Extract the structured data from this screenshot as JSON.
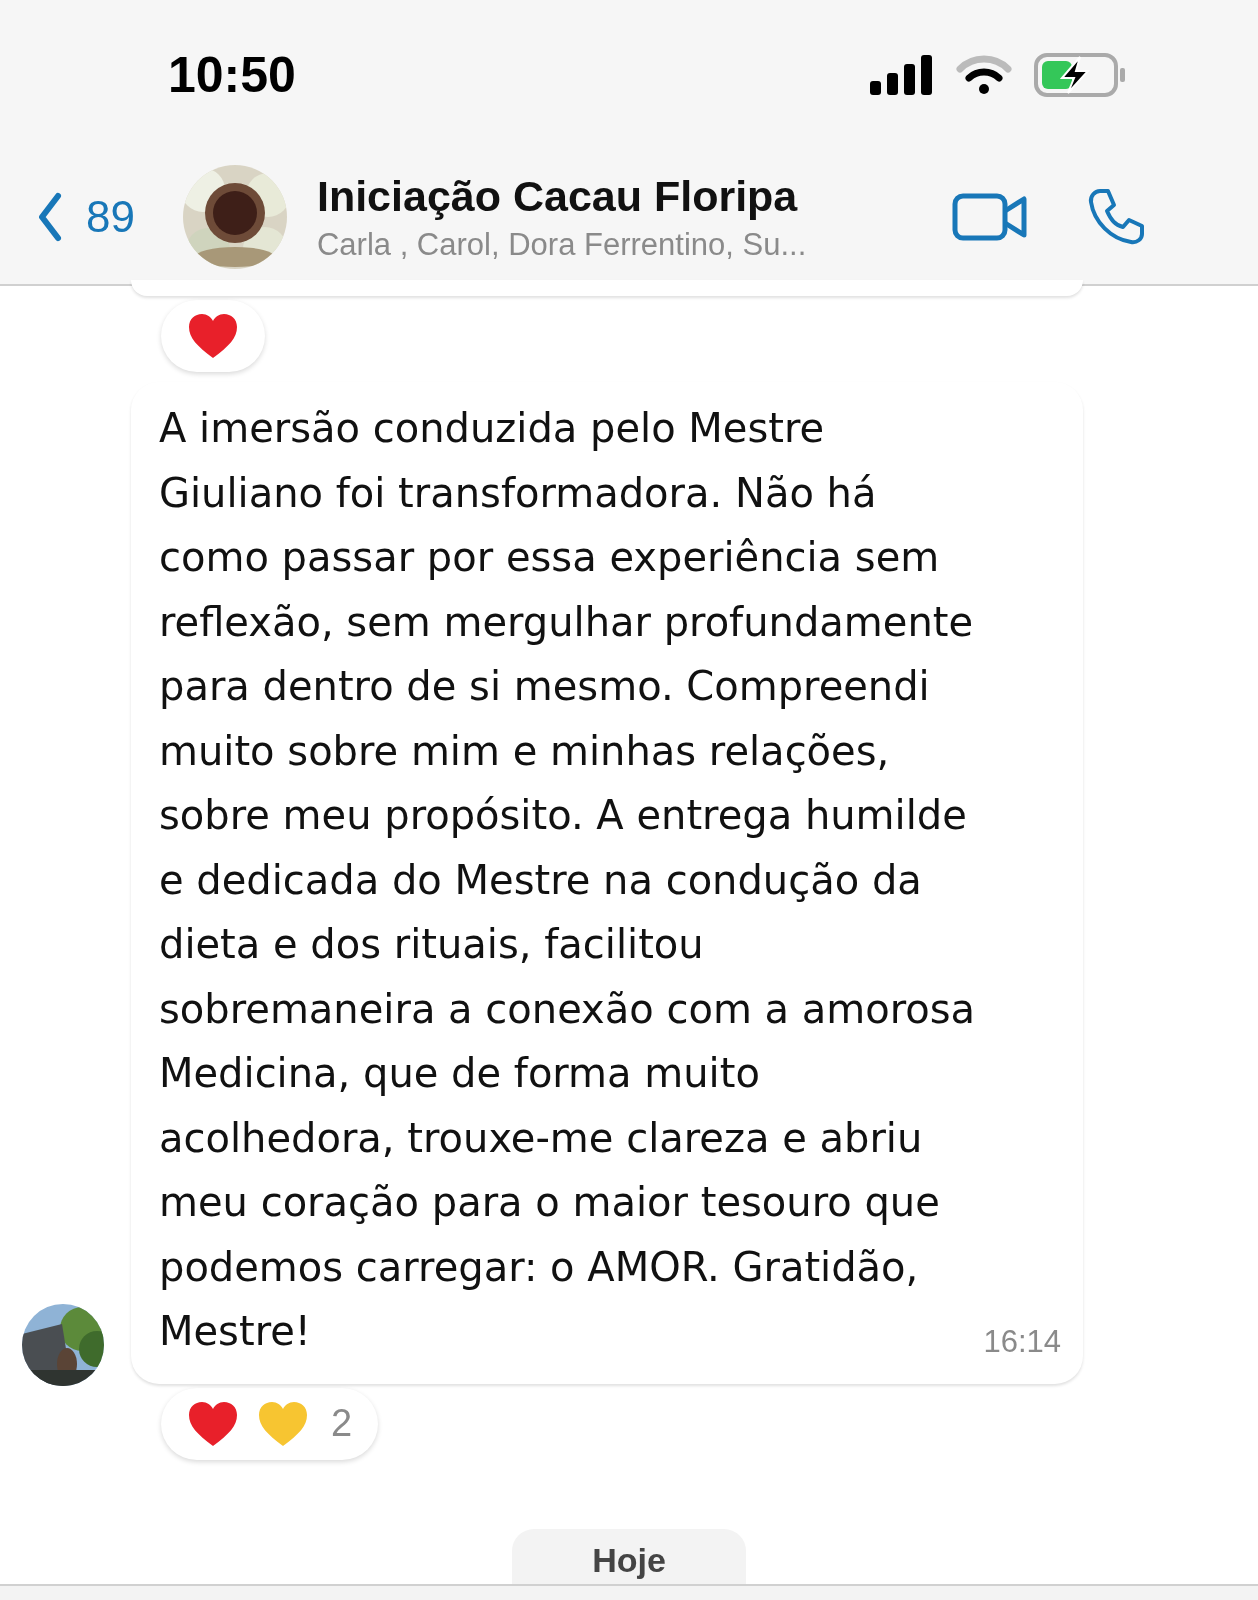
{
  "status_bar": {
    "time": "10:50"
  },
  "header": {
    "back_count": "89",
    "title": "Iniciação Cacau Floripa",
    "subtitle": "Carla , Carol, Dora Ferrentino, Su..."
  },
  "messages": [
    {
      "kind": "fragment",
      "reactions": [
        {
          "color": "#e8202a"
        }
      ]
    },
    {
      "kind": "text",
      "lines": [
        "A imersão conduzida pelo Mestre",
        "Giuliano foi transformadora. Não há",
        "como passar por essa experiência sem",
        "reflexão, sem mergulhar profundamente",
        "para dentro de si mesmo. Compreendi",
        "muito sobre mim e minhas relações,",
        "sobre meu propósito. A entrega humilde",
        "e dedicada do Mestre na condução da",
        "dieta e dos rituais, facilitou",
        "sobremaneira a conexão com a amorosa",
        "Medicina, que de forma muito",
        "acolhedora, trouxe-me clareza e abriu",
        "meu coração para o maior tesouro que",
        "podemos carregar: o AMOR. Gratidão,",
        "Mestre!"
      ],
      "time": "16:14",
      "reactions": [
        {
          "color": "#e8202a"
        },
        {
          "color": "#f7c531"
        }
      ],
      "reaction_count": "2"
    }
  ],
  "date_chip": "Hoje"
}
